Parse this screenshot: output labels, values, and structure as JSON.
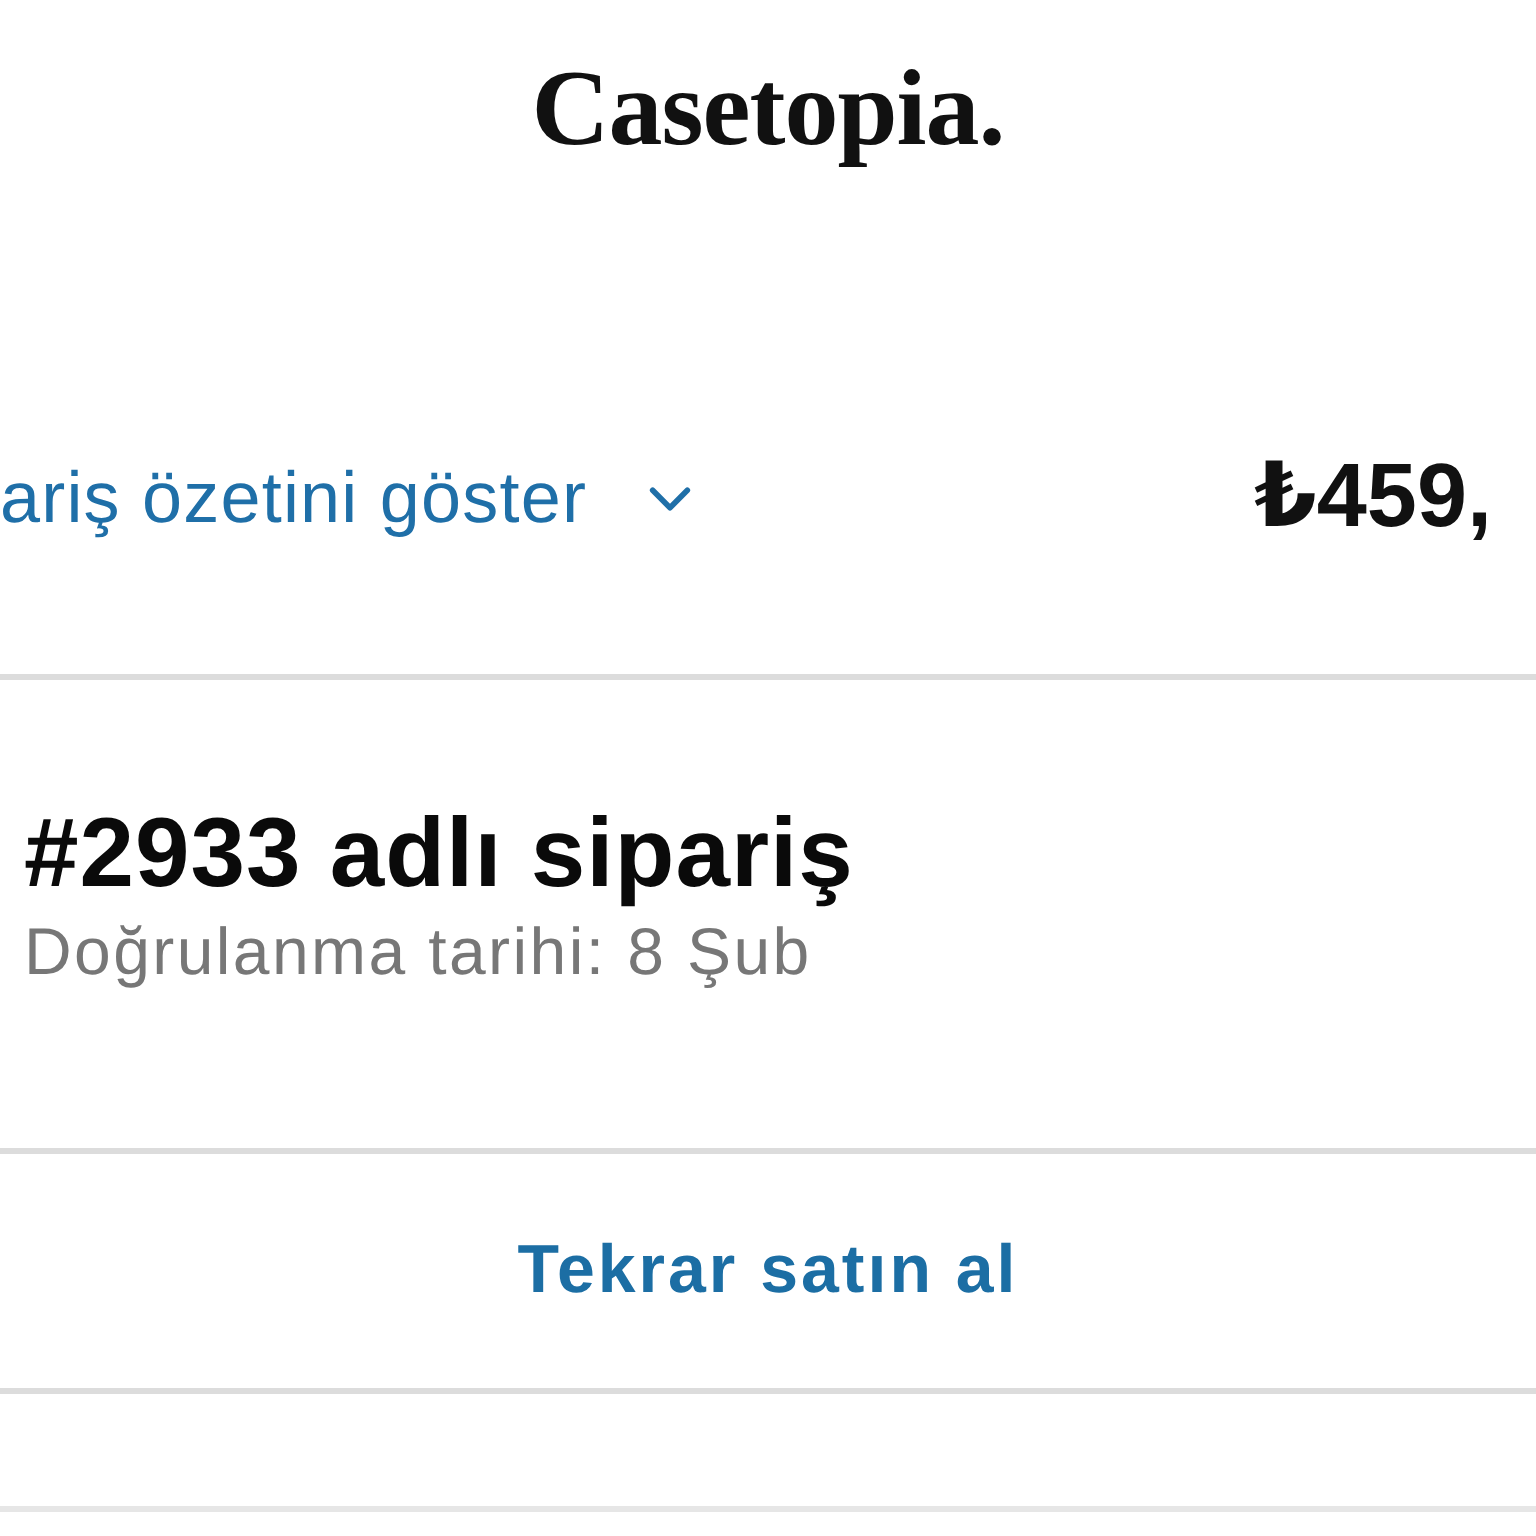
{
  "header": {
    "logo": "Casetopia."
  },
  "summary_bar": {
    "toggle_label": "ariş özetini göster",
    "expanded": false,
    "total": "₺459,"
  },
  "order": {
    "title": "#2933 adlı sipariş",
    "confirmation": "Doğrulanma tarihi: 8 Şub"
  },
  "actions": [
    {
      "label": "Tekrar satın al"
    }
  ]
}
